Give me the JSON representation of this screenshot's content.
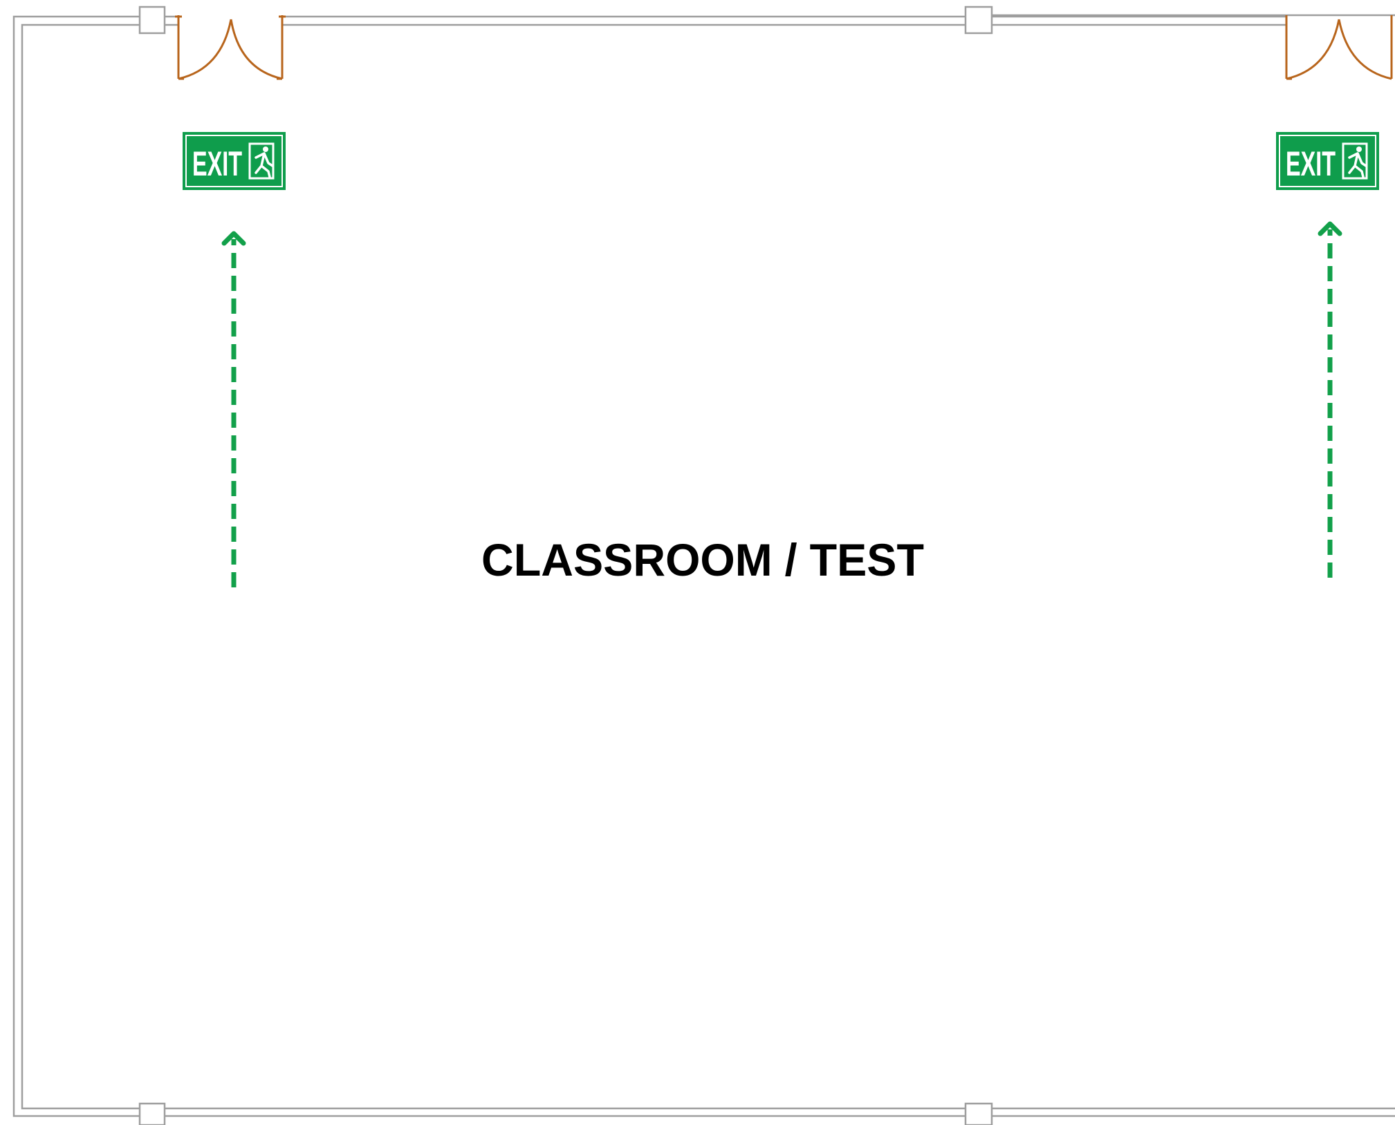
{
  "room": {
    "label": "CLASSROOM / TEST"
  },
  "exits": [
    {
      "sign_text": "EXIT",
      "icon": "running-person-icon"
    },
    {
      "sign_text": "EXIT",
      "icon": "running-person-icon"
    }
  ],
  "colors": {
    "wall": "#9e9e9e",
    "door": "#b8651c",
    "exit_green": "#0f9d4c",
    "route_arrow": "#12a04a",
    "label": "#000000"
  }
}
